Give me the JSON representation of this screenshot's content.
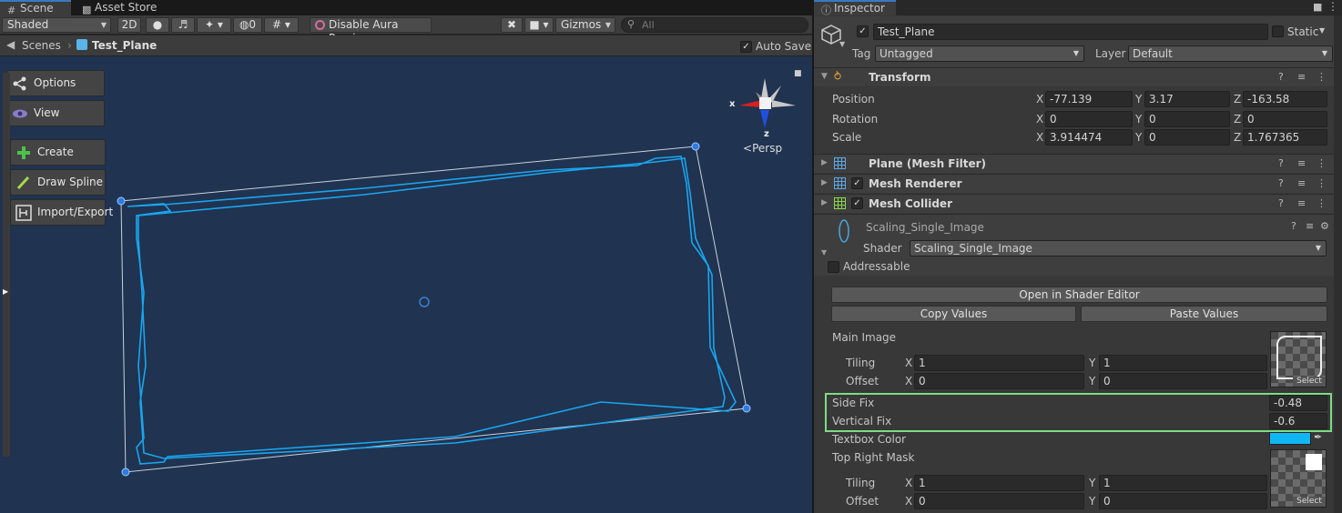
{
  "scene_tabs": {
    "scene": "Scene",
    "asset_store": "Asset Store"
  },
  "scene_toolbar": {
    "shading": "Shaded",
    "mode_2d": "2D",
    "hidden_count": "0",
    "aura": "Disable Aura Preview",
    "gizmos": "Gizmos",
    "search_placeholder": "All"
  },
  "breadcrumb": {
    "scenes": "Scenes",
    "object": "Test_Plane",
    "auto_save": "Auto Save"
  },
  "spline_tools": {
    "options": "Options",
    "view": "View",
    "create": "Create",
    "draw_spline": "Draw Spline",
    "import_export": "Import/Export"
  },
  "gizmo": {
    "x_label": "x",
    "z_label": "z",
    "persp": "Persp"
  },
  "inspector": {
    "tab": "Inspector",
    "object_name": "Test_Plane",
    "static_label": "Static",
    "tag_label": "Tag",
    "tag_value": "Untagged",
    "layer_label": "Layer",
    "layer_value": "Default",
    "transform": {
      "title": "Transform",
      "position_label": "Position",
      "rotation_label": "Rotation",
      "scale_label": "Scale",
      "axis_x": "X",
      "axis_y": "Y",
      "axis_z": "Z",
      "position": {
        "x": "-77.139",
        "y": "3.17",
        "z": "-163.58"
      },
      "rotation": {
        "x": "0",
        "y": "0",
        "z": "0"
      },
      "scale": {
        "x": "3.914474",
        "y": "0",
        "z": "1.767365"
      }
    },
    "mesh_filter": "Plane (Mesh Filter)",
    "mesh_renderer": "Mesh Renderer",
    "mesh_collider": "Mesh Collider",
    "material": {
      "name": "Scaling_Single_Image",
      "shader_label": "Shader",
      "shader_value": "Scaling_Single_Image",
      "addressable": "Addressable",
      "open_shader_editor": "Open in Shader Editor",
      "copy_values": "Copy Values",
      "paste_values": "Paste Values",
      "main_image_label": "Main Image",
      "tiling_label": "Tiling",
      "offset_label": "Offset",
      "main_tiling": {
        "x": "1",
        "y": "1"
      },
      "main_offset": {
        "x": "0",
        "y": "0"
      },
      "side_fix_label": "Side Fix",
      "side_fix_value": "-0.48",
      "vertical_fix_label": "Vertical Fix",
      "vertical_fix_value": "-0.6",
      "textbox_color_label": "Textbox Color",
      "textbox_color": "#10b6f2",
      "top_right_mask_label": "Top Right Mask",
      "mask_tiling": {
        "x": "1",
        "y": "1"
      },
      "mask_offset": {
        "x": "0",
        "y": "0"
      },
      "select_label": "Select"
    }
  },
  "colors": {
    "highlight": "#7ddc82",
    "wire": "#1aa5ee",
    "viewport": "#203350"
  }
}
